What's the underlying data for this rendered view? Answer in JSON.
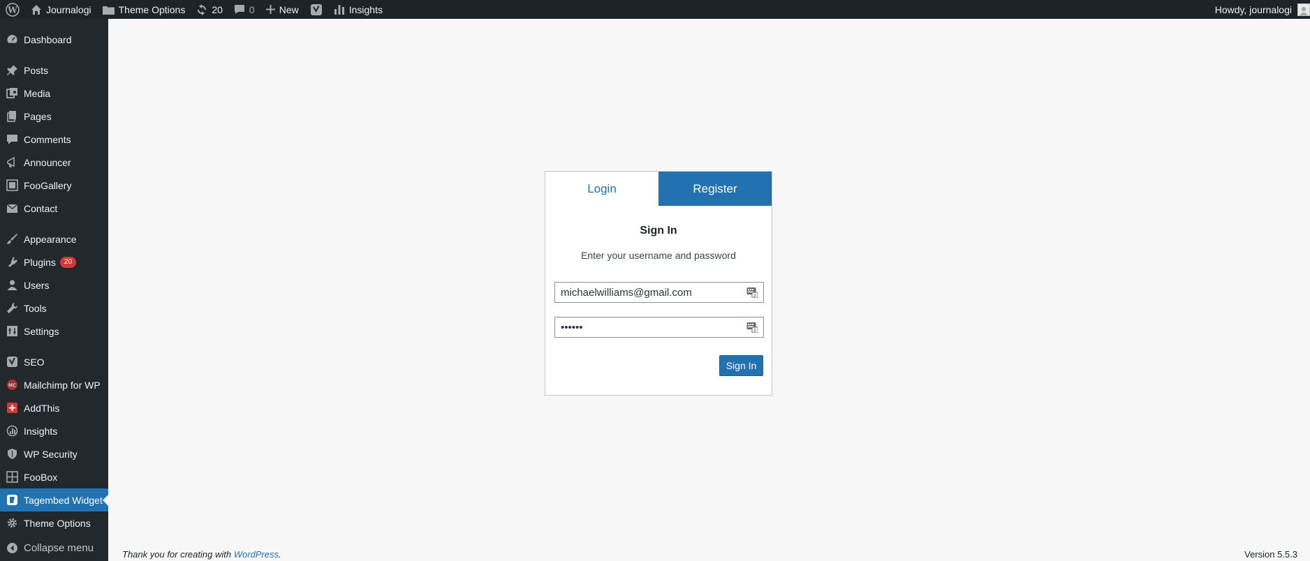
{
  "adminbar": {
    "site_name": "Journalogi",
    "theme_options": "Theme Options",
    "updates_count": "20",
    "comments_count": "0",
    "new_label": "New",
    "insights_label": "Insights",
    "greeting": "Howdy, journalogi"
  },
  "sidebar": {
    "items": [
      {
        "label": "Dashboard",
        "icon": "dashboard-icon"
      },
      {
        "label": "Posts",
        "icon": "pin-icon"
      },
      {
        "label": "Media",
        "icon": "media-icon"
      },
      {
        "label": "Pages",
        "icon": "pages-icon"
      },
      {
        "label": "Comments",
        "icon": "comment-icon"
      },
      {
        "label": "Announcer",
        "icon": "megaphone-icon"
      },
      {
        "label": "FooGallery",
        "icon": "gallery-icon"
      },
      {
        "label": "Contact",
        "icon": "mail-icon"
      },
      {
        "label": "Appearance",
        "icon": "brush-icon"
      },
      {
        "label": "Plugins",
        "icon": "plugin-icon",
        "badge": "20"
      },
      {
        "label": "Users",
        "icon": "user-icon"
      },
      {
        "label": "Tools",
        "icon": "wrench-icon"
      },
      {
        "label": "Settings",
        "icon": "settings-icon"
      },
      {
        "label": "SEO",
        "icon": "yoast-icon"
      },
      {
        "label": "Mailchimp for WP",
        "icon": "mailchimp-icon"
      },
      {
        "label": "AddThis",
        "icon": "addthis-icon"
      },
      {
        "label": "Insights",
        "icon": "insights-icon"
      },
      {
        "label": "WP Security",
        "icon": "shield-icon"
      },
      {
        "label": "FooBox",
        "icon": "grid-icon"
      },
      {
        "label": "Tagembed Widget",
        "icon": "tagembed-icon",
        "active": true
      },
      {
        "label": "Theme Options",
        "icon": "gear-icon"
      }
    ],
    "collapse_label": "Collapse menu"
  },
  "login": {
    "tab_login": "Login",
    "tab_register": "Register",
    "title": "Sign In",
    "subtitle": "Enter your username and password",
    "email_value": "michaelwilliams@gmail.com",
    "password_value": "••••••",
    "submit_label": "Sign In"
  },
  "footer": {
    "thanks_prefix": "Thank you for creating with ",
    "wordpress_link": "WordPress",
    "thanks_suffix": ".",
    "version": "Version 5.5.3"
  },
  "colors": {
    "accent": "#2271b1",
    "sidebar_bg": "#23282d",
    "adminbar_bg": "#1d2327",
    "badge": "#d63638"
  }
}
